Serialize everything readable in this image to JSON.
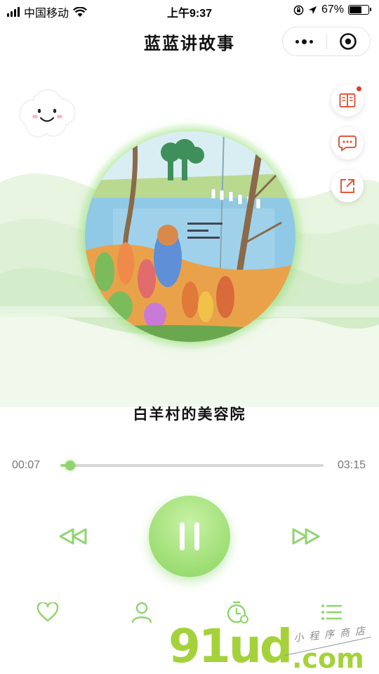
{
  "status_bar": {
    "carrier": "中国移动",
    "time": "上午9:37",
    "battery_percent": "67%",
    "battery_level": 0.67,
    "icons": [
      "signal-icon",
      "wifi-icon",
      "orientation-lock-icon",
      "location-icon",
      "battery-icon"
    ]
  },
  "nav": {
    "title": "蓝蓝讲故事",
    "capsule": {
      "more_icon": "more-dots-icon",
      "close_icon": "close-miniprogram-icon"
    }
  },
  "side_actions": [
    {
      "name": "book-icon",
      "has_badge": true
    },
    {
      "name": "comment-icon",
      "has_badge": false
    },
    {
      "name": "share-icon",
      "has_badge": false
    }
  ],
  "player": {
    "story_title": "白羊村的美容院",
    "current_time": "00:07",
    "total_time": "03:15",
    "progress": 0.036,
    "state": "playing"
  },
  "controls": [
    "rewind-icon",
    "pause-icon",
    "fast-forward-icon"
  ],
  "bottom_tabs": [
    "heart-icon",
    "user-icon",
    "timer-icon",
    "playlist-icon"
  ],
  "watermark": {
    "logo": "91ud",
    "domain": ".com",
    "tagline": "小程序商店"
  },
  "colors": {
    "accent": "#9ad87e",
    "accent_dark": "#7cc85e",
    "badge": "#e23b2e",
    "side_icon": "#e05a3c"
  }
}
